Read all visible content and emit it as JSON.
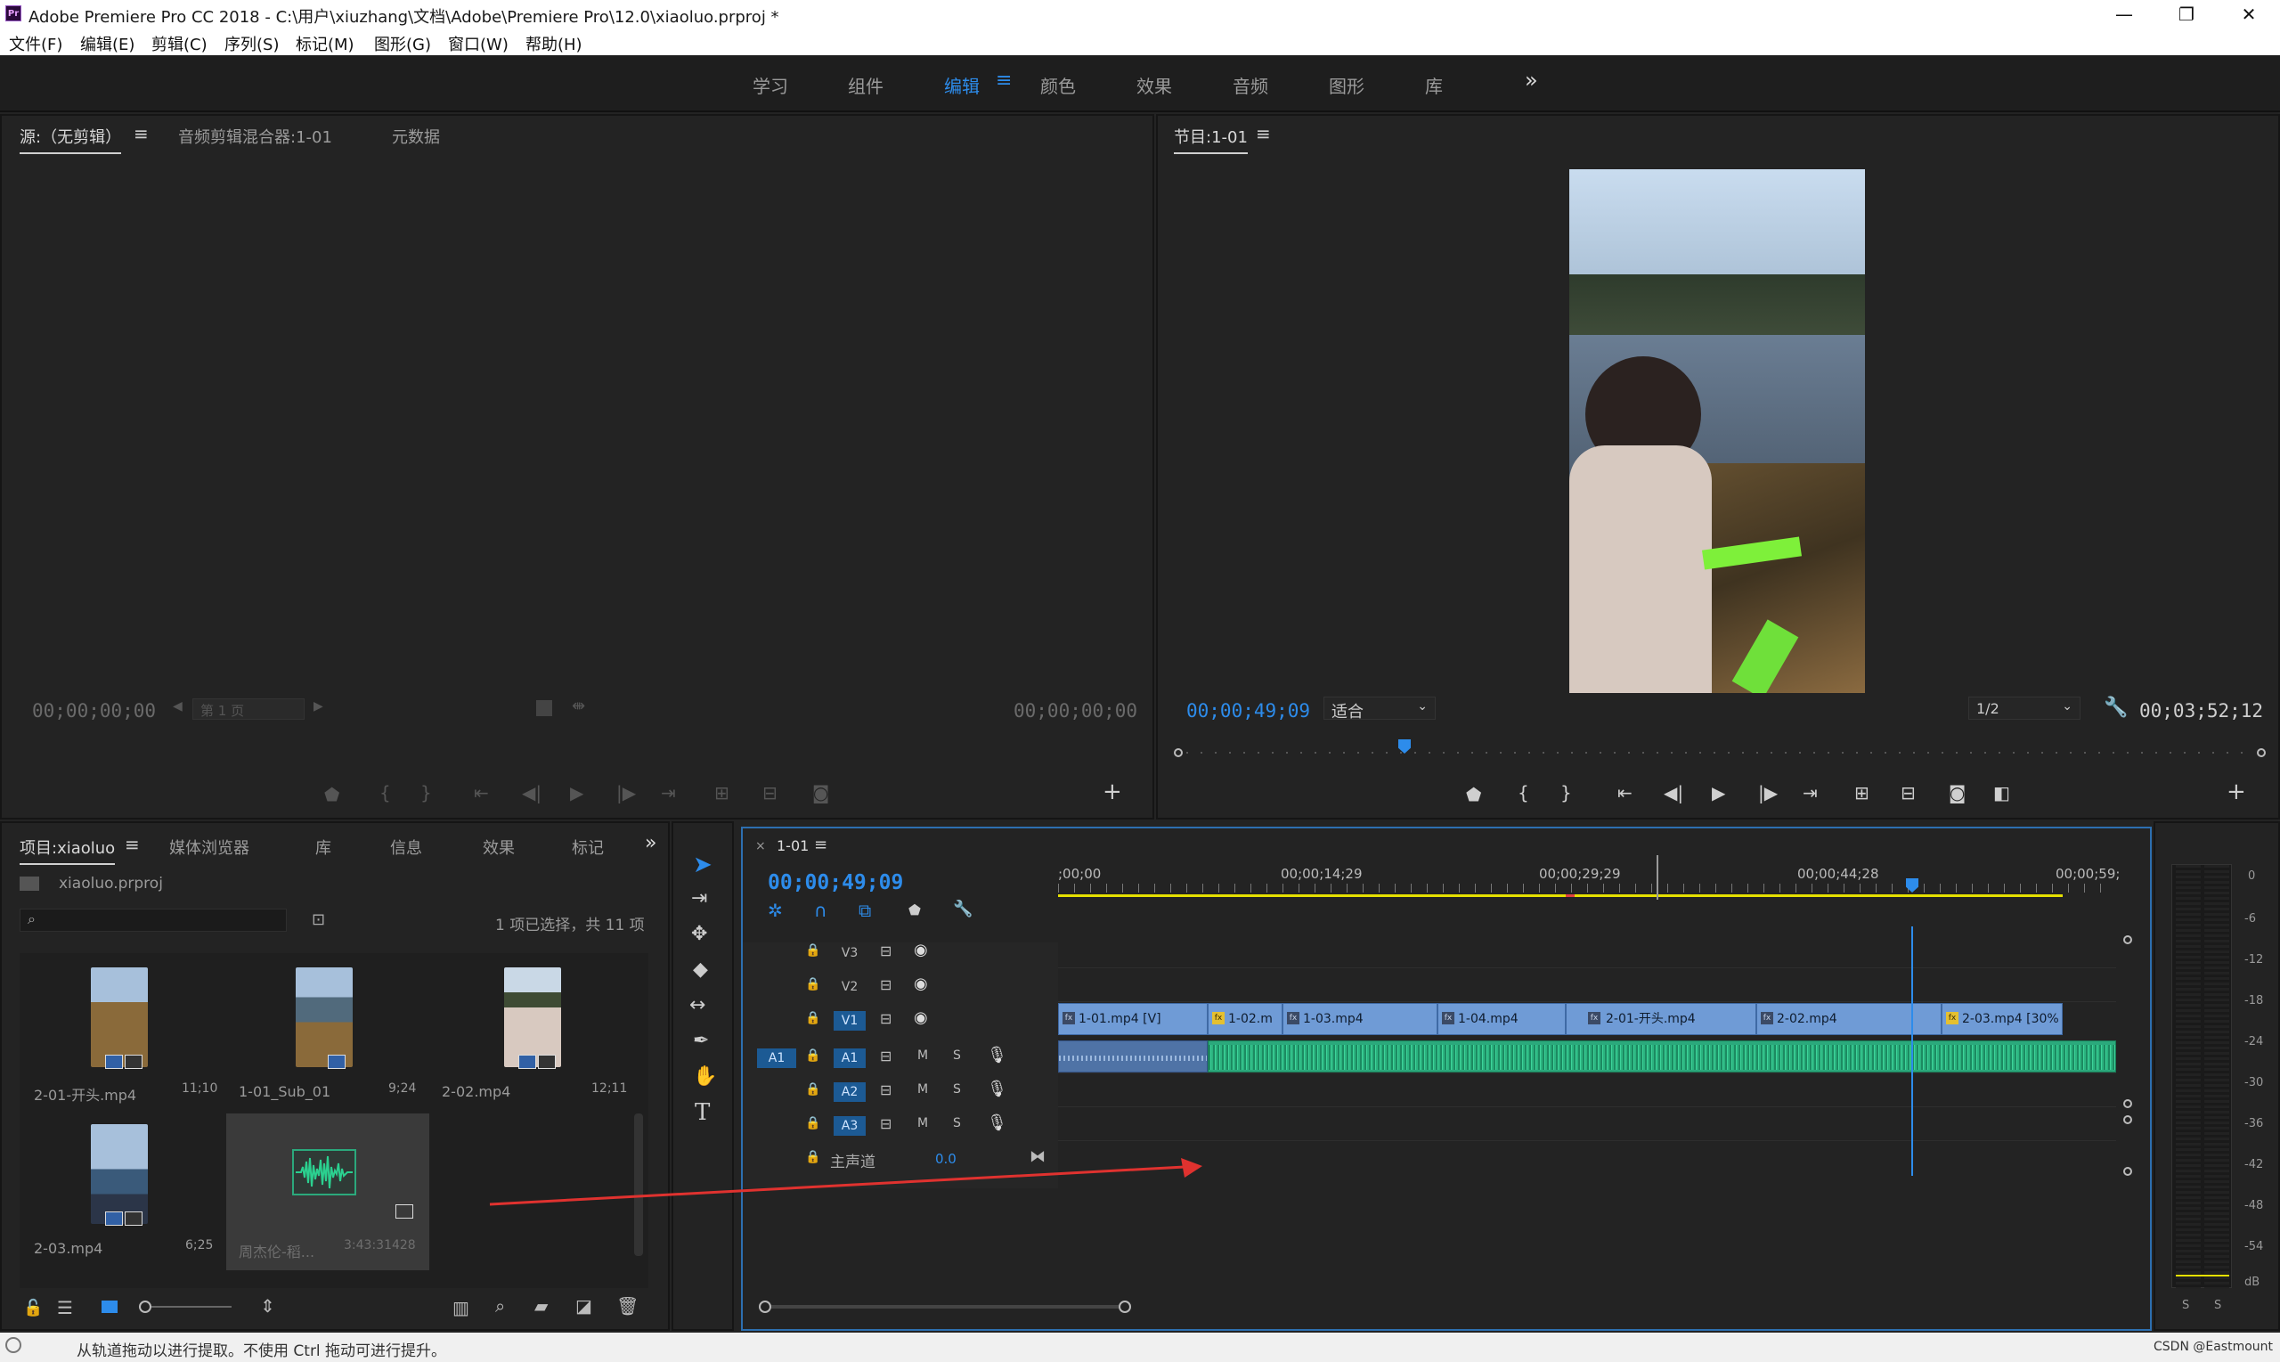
{
  "window": {
    "title": "Adobe Premiere Pro CC 2018 - C:\\用户\\xiuzhang\\文档\\Adobe\\Premiere Pro\\12.0\\xiaoluo.prproj *",
    "logo_text": "Pr",
    "controls": [
      "—",
      "❐",
      "✕"
    ]
  },
  "menu": [
    "文件(F)",
    "编辑(E)",
    "剪辑(C)",
    "序列(S)",
    "标记(M)",
    "图形(G)",
    "窗口(W)",
    "帮助(H)"
  ],
  "workspaces": {
    "items": [
      "学习",
      "组件",
      "编辑",
      "颜色",
      "效果",
      "音频",
      "图形",
      "库"
    ],
    "active": "编辑",
    "more": "»"
  },
  "source_panel": {
    "tabs": [
      "源:（无剪辑）",
      "音频剪辑混合器:1-01",
      "元数据"
    ],
    "timecode_in": "00;00;00;00",
    "timecode_out": "00;00;00;00",
    "page_select": "第 1 页"
  },
  "program_panel": {
    "tab": "节目:1-01",
    "timecode": "00;00;49;09",
    "fit_label": "适合",
    "resolution": "1/2",
    "duration": "00;03;52;12"
  },
  "project_panel": {
    "tabs": [
      "项目:xiaoluo",
      "媒体浏览器",
      "库",
      "信息",
      "效果",
      "标记"
    ],
    "file": "xiaoluo.prproj",
    "search_placeholder": "",
    "selection_info": "1 项已选择，共 11 项",
    "items": [
      {
        "name": "2-01-开头.mp4",
        "duration": "11;10"
      },
      {
        "name": "1-01_Sub_01",
        "duration": "9;24"
      },
      {
        "name": "2-02.mp4",
        "duration": "12;11"
      },
      {
        "name": "2-03.mp4",
        "duration": "6;25"
      },
      {
        "name": "周杰伦-稻...",
        "duration": "3:43:31428"
      }
    ]
  },
  "timeline": {
    "tab": "1-01",
    "timecode": "00;00;49;09",
    "ruler": [
      ";00;00",
      "00;00;14;29",
      "00;00;29;29",
      "00;00;44;28",
      "00;00;59;"
    ],
    "video_tracks": [
      "V3",
      "V2",
      "V1"
    ],
    "audio_tracks": [
      "A1",
      "A2",
      "A3"
    ],
    "source_patch": "A1",
    "master_label": "主声道",
    "master_value": "0.0",
    "track_buttons": {
      "mute": "M",
      "solo": "S"
    },
    "video_clips": [
      "1-01.mp4 [V]",
      "1-02.m",
      "1-03.mp4",
      "1-04.mp4",
      "2-01-开头.mp4",
      "2-02.mp4",
      "2-03.mp4 [30%"
    ]
  },
  "audio_meter": {
    "scale": [
      "0",
      "-6",
      "-12",
      "-18",
      "-24",
      "-30",
      "-36",
      "-42",
      "-48",
      "-54",
      "dB"
    ],
    "solo_labels": [
      "S",
      "S"
    ]
  },
  "status_bar": {
    "message": "从轨道拖动以进行提取。不使用 Ctrl 拖动可进行提升。",
    "watermark": "CSDN @Eastmount"
  },
  "colors": {
    "accent": "#2d8ceb",
    "video_clip": "#6f9bd6",
    "audio_clip": "#2ba97c",
    "work_area": "#e5e000",
    "annotation_arrow": "#e0322f"
  }
}
